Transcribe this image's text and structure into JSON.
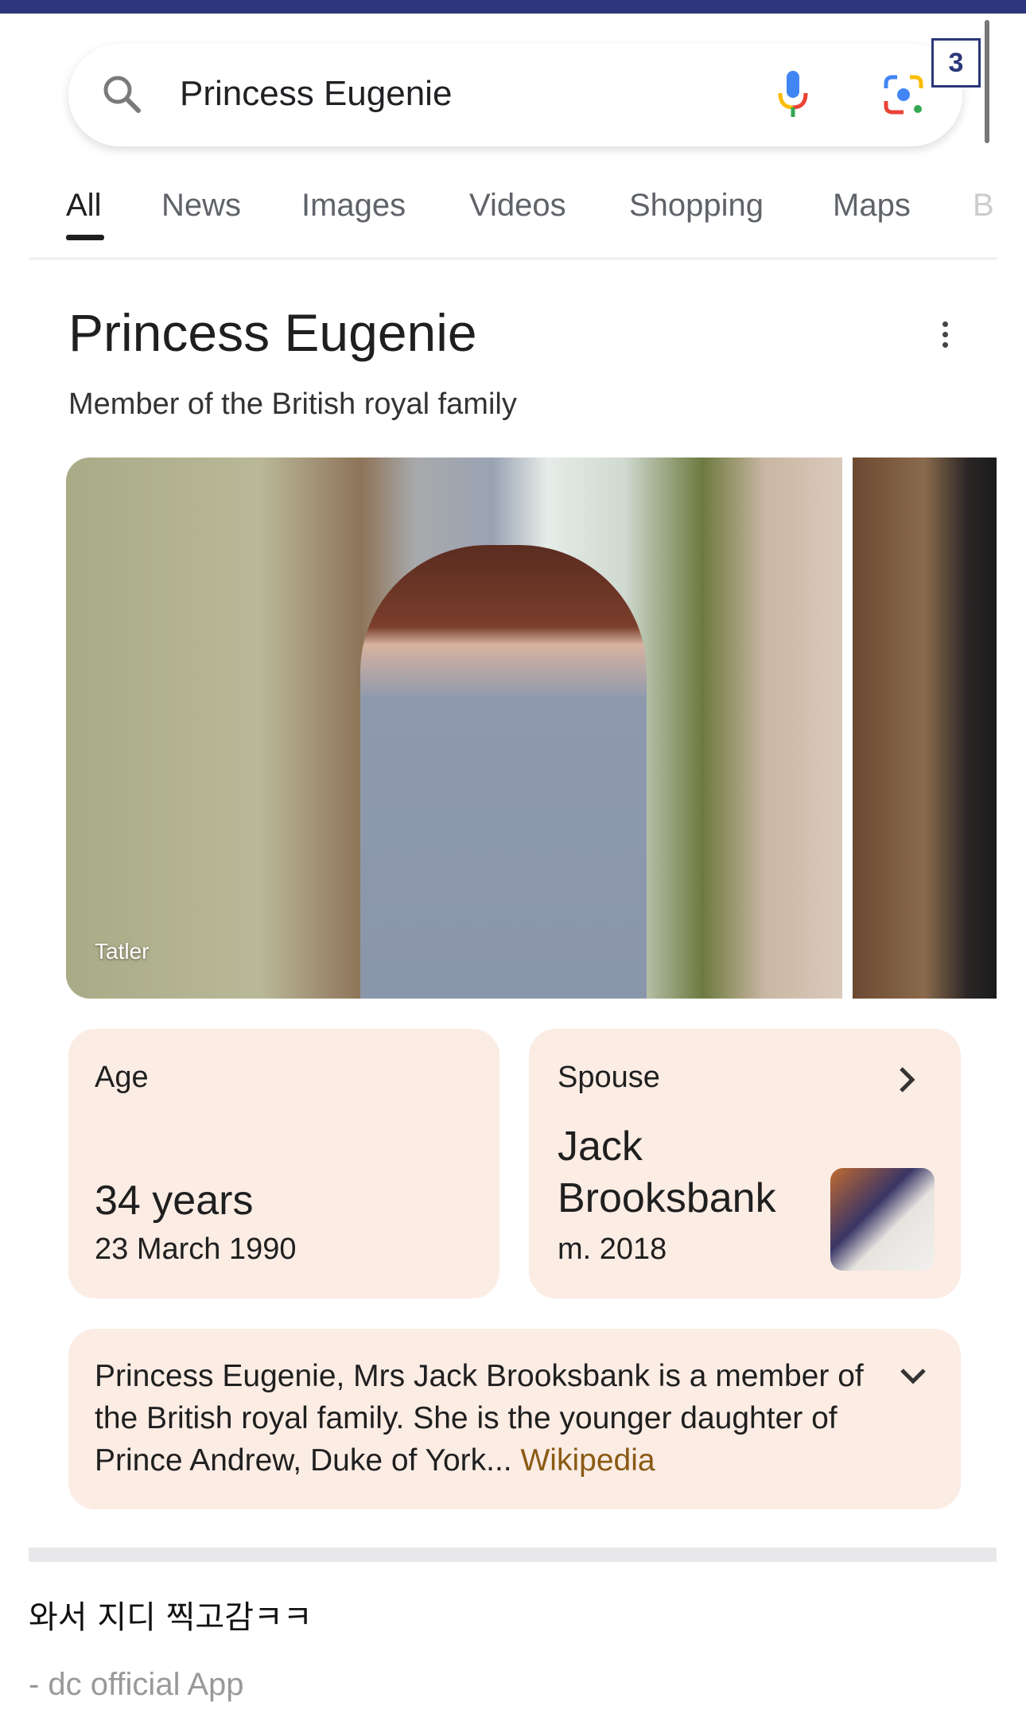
{
  "search": {
    "query": "Princess Eugenie",
    "badge": "3"
  },
  "tabs": [
    {
      "label": "All",
      "active": true
    },
    {
      "label": "News"
    },
    {
      "label": "Images"
    },
    {
      "label": "Videos"
    },
    {
      "label": "Shopping"
    },
    {
      "label": "Maps"
    },
    {
      "label": "B"
    }
  ],
  "panel": {
    "title": "Princess Eugenie",
    "subtitle": "Member of the British royal family",
    "image_source": "Tatler",
    "age": {
      "label": "Age",
      "value": "34 years",
      "birth": "23 March 1990"
    },
    "spouse": {
      "label": "Spouse",
      "name_line1": "Jack",
      "name_line2": "Brooksbank",
      "married": "m. 2018"
    },
    "description": "Princess Eugenie, Mrs Jack Brooksbank is a member of the British royal family. She is the younger daughter of Prince Andrew, Duke of York... ",
    "source_link": "Wikipedia"
  },
  "post": {
    "comment": "와서 지디 찍고감ㅋㅋ",
    "footer": "- dc official App"
  },
  "colors": {
    "topbar": "#2b377a",
    "card_bg": "#fbece4",
    "wiki_link": "#8a5a14"
  }
}
